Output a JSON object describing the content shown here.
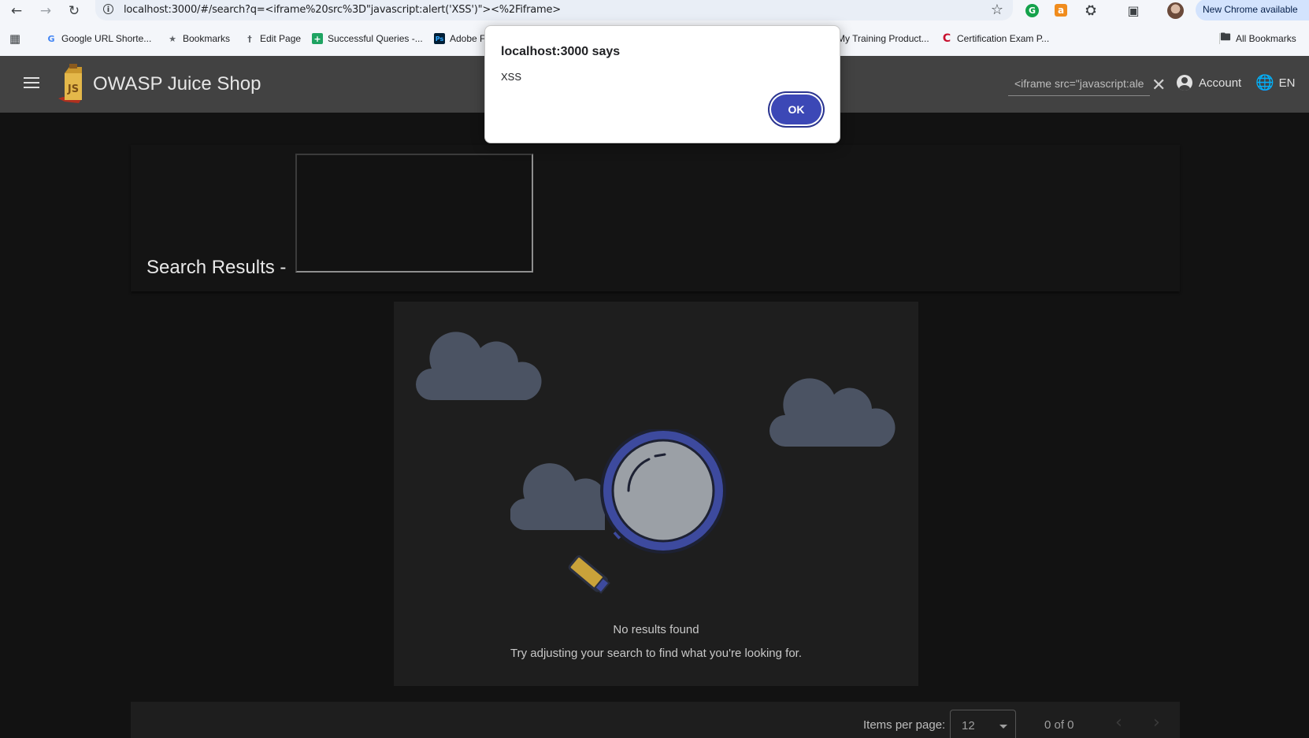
{
  "browser": {
    "url": "localhost:3000/#/search?q=<iframe%20src%3D\"javascript:alert('XSS')\"><%2Fiframe>",
    "new_chrome_label": "New Chrome available",
    "bookmarks": [
      {
        "label": "Google URL Shorte...",
        "icon": "google-icon"
      },
      {
        "label": "Bookmarks",
        "icon": "star-icon"
      },
      {
        "label": "Edit Page",
        "icon": "pin-icon"
      },
      {
        "label": "Successful Queries -...",
        "icon": "sheets-icon"
      },
      {
        "label": "Adobe F",
        "icon": "photoshop-icon"
      },
      {
        "label": "My Training Product...",
        "icon": "none"
      },
      {
        "label": "Certification Exam P...",
        "icon": "c-logo-icon"
      }
    ],
    "all_bookmarks_label": "All Bookmarks"
  },
  "app": {
    "title": "OWASP Juice Shop",
    "search_value": "<iframe src=\"javascript:ale",
    "account_label": "Account",
    "language_label": "EN"
  },
  "results": {
    "title": "Search Results -",
    "empty_title": "No results found",
    "empty_hint": "Try adjusting your search to find what you're looking for."
  },
  "paginator": {
    "items_per_page_label": "Items per page:",
    "items_per_page_value": "12",
    "range_label": "0 of 0"
  },
  "dialog": {
    "title": "localhost:3000 says",
    "message": "XSS",
    "ok_label": "OK"
  },
  "colors": {
    "toolbar": "#424242",
    "background": "#121212",
    "ok_button": "#3c48b6",
    "cloud": "#4b5363"
  }
}
